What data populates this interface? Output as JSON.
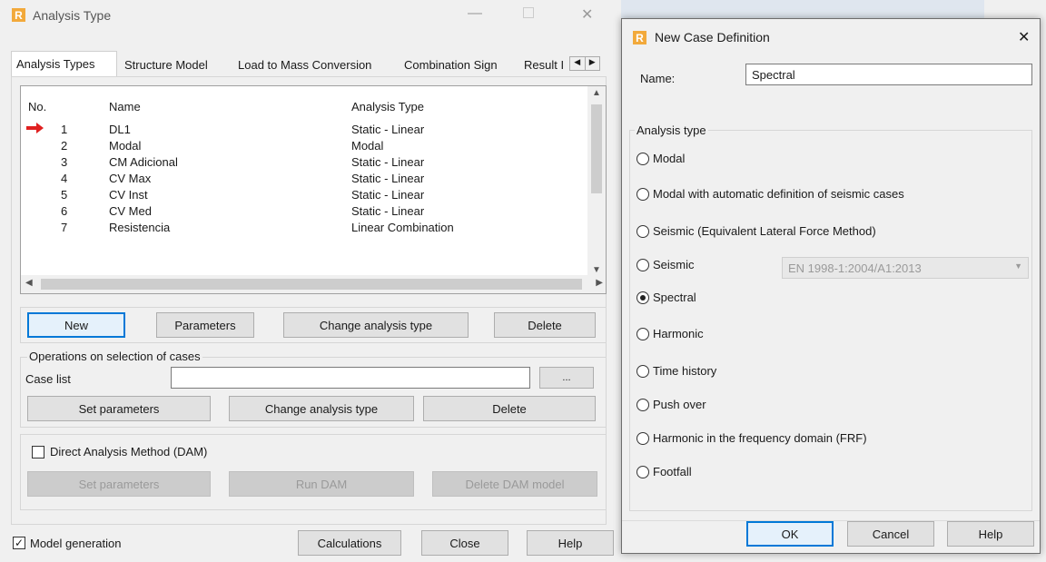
{
  "analysis_dialog": {
    "title": "Analysis Type",
    "tabs": [
      "Analysis Types",
      "Structure Model",
      "Load to Mass Conversion",
      "Combination Sign",
      "Result I"
    ],
    "table": {
      "headers": [
        "No.",
        "Name",
        "Analysis Type"
      ],
      "rows": [
        {
          "no": "1",
          "name": "DL1",
          "type": "Static - Linear"
        },
        {
          "no": "2",
          "name": "Modal",
          "type": "Modal"
        },
        {
          "no": "3",
          "name": "CM Adicional",
          "type": "Static - Linear"
        },
        {
          "no": "4",
          "name": "CV Max",
          "type": "Static - Linear"
        },
        {
          "no": "5",
          "name": "CV Inst",
          "type": "Static - Linear"
        },
        {
          "no": "6",
          "name": "CV Med",
          "type": "Static - Linear"
        },
        {
          "no": "7",
          "name": "Resistencia",
          "type": "Linear Combination"
        }
      ]
    },
    "buttons": {
      "new": "New",
      "parameters": "Parameters",
      "change_type": "Change analysis type",
      "delete": "Delete"
    },
    "operations": {
      "group_label": "Operations on selection of cases",
      "case_list_label": "Case list",
      "case_list_value": "",
      "browse": "...",
      "set_parameters": "Set parameters",
      "change_type": "Change analysis type",
      "delete": "Delete"
    },
    "dam": {
      "checkbox_label": "Direct Analysis Method (DAM)",
      "checked": false,
      "set_parameters": "Set parameters",
      "run": "Run DAM",
      "delete_model": "Delete DAM model"
    },
    "footer": {
      "model_generation": "Model generation",
      "model_generation_checked": true,
      "calculations": "Calculations",
      "close": "Close",
      "help": "Help"
    }
  },
  "case_dialog": {
    "title": "New Case Definition",
    "name_label": "Name:",
    "name_value": "Spectral",
    "group_label": "Analysis type",
    "options": [
      "Modal",
      "Modal with automatic definition of seismic cases",
      "Seismic (Equivalent Lateral Force Method)",
      "Seismic",
      "Spectral",
      "Harmonic",
      "Time history",
      "Push over",
      "Harmonic in the frequency domain (FRF)",
      "Footfall"
    ],
    "selected": "Spectral",
    "seismic_code": "EN 1998-1:2004/A1:2013",
    "buttons": {
      "ok": "OK",
      "cancel": "Cancel",
      "help": "Help"
    }
  },
  "colors": {
    "accent": "#0078d7",
    "logo": "#f2a93b",
    "arrow": "#e02020"
  }
}
